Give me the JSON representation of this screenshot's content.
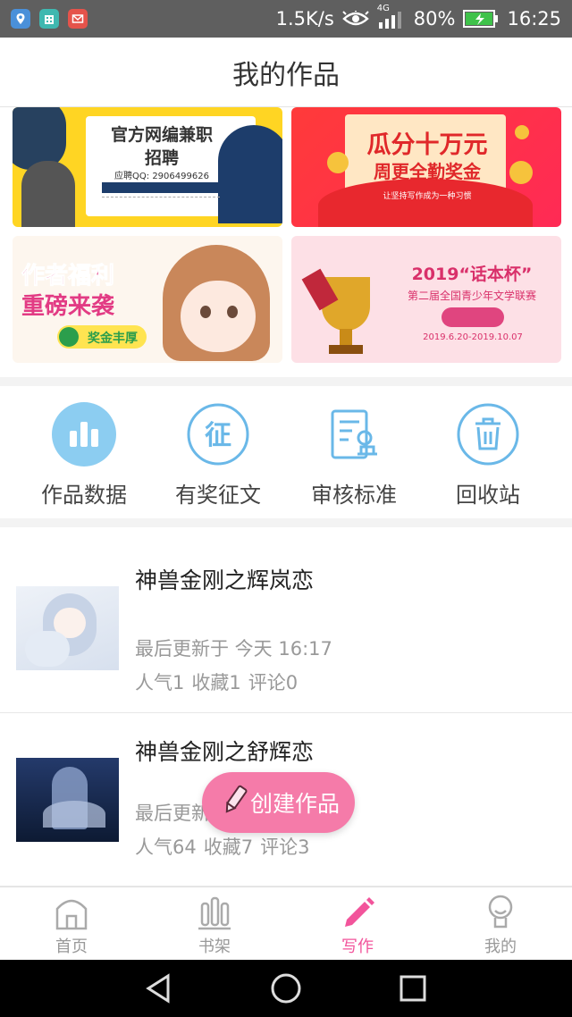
{
  "status_bar": {
    "net_speed": "1.5K/s",
    "network": "4G",
    "battery": "80%",
    "time": "16:25"
  },
  "header": {
    "title": "我的作品"
  },
  "banners": [
    {
      "line1": "官方网编兼职",
      "line2": "招聘",
      "sub": "应聘QQ: 2906499626",
      "color": "#ffd523"
    },
    {
      "line1": "瓜分十万元",
      "line2": "周更全勤奖金",
      "sub": "让坚持写作成为一种习惯",
      "color": "#ff3a3a"
    },
    {
      "line1": "作者福利",
      "line2": "重磅来袭",
      "sub": "奖金丰厚",
      "color": "#fdf6ee"
    },
    {
      "line1": "2019“话本杯”",
      "line2": "第二届全国青少年文学联赛",
      "sub": "2019.6.20-2019.10.07",
      "color": "#fde0e6"
    }
  ],
  "shortcuts": [
    {
      "label": "作品数据",
      "icon": "bar-chart-icon"
    },
    {
      "label": "有奖征文",
      "icon": "contest-icon",
      "glyph": "征"
    },
    {
      "label": "审核标准",
      "icon": "review-doc-icon"
    },
    {
      "label": "回收站",
      "icon": "trash-icon"
    }
  ],
  "works": [
    {
      "title": "神兽金刚之辉岚恋",
      "updated": "最后更新于 今天 16:17",
      "popularity": "人气1",
      "favorites": "收藏1",
      "comments": "评论0"
    },
    {
      "title": "神兽金刚之舒辉恋",
      "updated": "最后更新",
      "popularity": "人气64",
      "favorites": "收藏7",
      "comments": "评论3"
    }
  ],
  "fab": {
    "label": "创建作品"
  },
  "bottom_nav": [
    {
      "label": "首页",
      "icon": "home-icon"
    },
    {
      "label": "书架",
      "icon": "bookshelf-icon"
    },
    {
      "label": "写作",
      "icon": "pencil-icon",
      "active": true
    },
    {
      "label": "我的",
      "icon": "profile-icon"
    }
  ],
  "colors": {
    "accent": "#f2549b",
    "icon_blue": "#6ab8e8",
    "fab": "#f57ba9"
  }
}
